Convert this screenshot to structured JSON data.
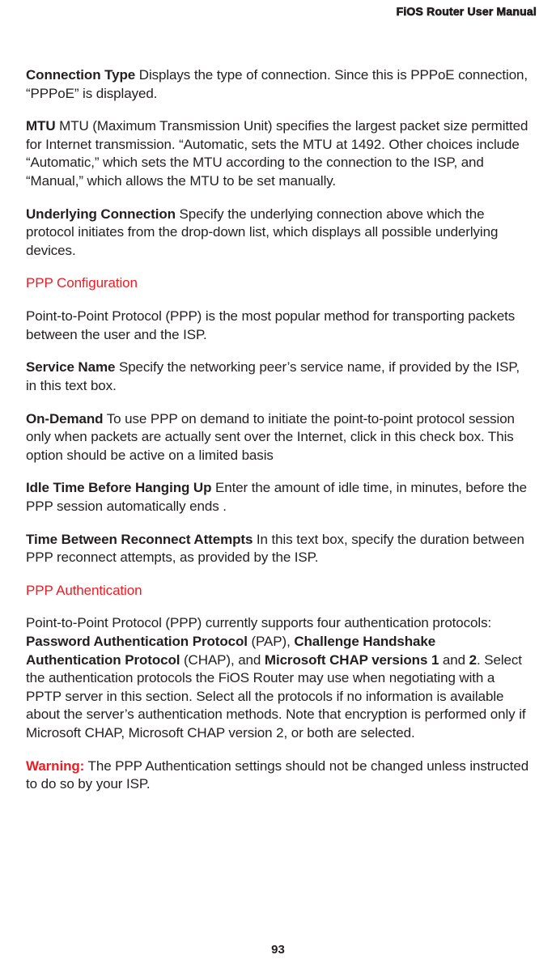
{
  "header": {
    "running_title": "FiOS Router User Manual"
  },
  "content": {
    "p1_term": "Connection Type",
    "p1_body": "  Displays the type of connection. Since this is PPPoE connection, “PPPoE” is displayed.",
    "p2_term": "MTU",
    "p2_body": "  MTU (Maximum Transmission Unit) specifies the largest packet size permitted for Internet transmission. “Automatic, sets the MTU at 1492. Other choices include “Automatic,” which sets the MTU according to the connection to the ISP, and “Manual,” which allows the MTU to be set manually.",
    "p3_term": "Underlying Connection",
    "p3_body": "  Specify the underlying connection above which the protocol initiates from the drop-down list, which displays all possible underlying devices.",
    "h1": "PPP Configuration",
    "p4": "Point-to-Point Protocol (PPP) is the most popular method for transporting packets between the user and the ISP.",
    "p5_term": "Service Name",
    "p5_body": "  Specify the networking peer’s service name, if provided by the ISP, in this text box.",
    "p6_term": "On-Demand",
    "p6_body": "  To use PPP on demand to initiate the point-to-point protocol session only when packets are actually sent over the Internet, click in this check box. This option should be active on a limited basis",
    "p7_term": "Idle Time Before Hanging Up",
    "p7_body": "  Enter the amount of idle time, in minutes, before the PPP session automatically ends .",
    "p8_term": "Time Between Reconnect Attempts",
    "p8_body": "  In this text box, specify the duration between PPP reconnect attempts, as provided by the ISP.",
    "h2": "PPP Authentication",
    "p9_a": "Point-to-Point Protocol (PPP) currently supports four authentication protocols: ",
    "p9_b1": "Password Authentication Protocol",
    "p9_c": " (PAP), ",
    "p9_b2": "Challenge Handshake Authentication Protocol",
    "p9_d": " (CHAP), and ",
    "p9_b3": "Microsoft CHAP versions 1",
    "p9_e": " and ",
    "p9_b4": "2",
    "p9_f": ". Select the authentication protocols the FiOS Router may use when negotiating with a PPTP server in this section. Select all the protocols if no information is available about the server’s authentication methods. Note that encryption is performed only if Microsoft CHAP, Microsoft CHAP version 2, or both are selected.",
    "p10_label": "Warning:",
    "p10_body": " The PPP Authentication settings should not be changed unless instructed to do so by your ISP."
  },
  "footer": {
    "page_number": "93"
  }
}
